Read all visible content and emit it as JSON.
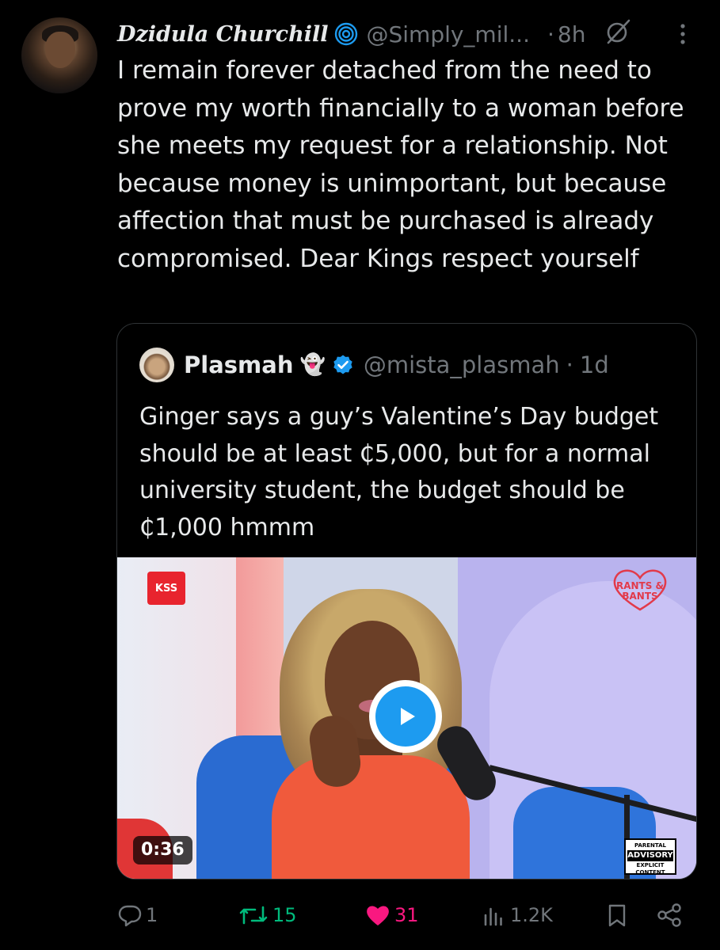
{
  "tweet": {
    "author_name": "Dzidula Churchill",
    "handle": "@Simply_mil...",
    "separator": "·",
    "time": "8h",
    "text": "I remain forever detached from the need to prove my worth financially to a woman before she meets my request for a relationship. Not because money is unimportant, but because affection that must be purchased is already compromised. Dear Kings respect yourself"
  },
  "quote": {
    "author_name": "Plasmah",
    "emoji": "👻",
    "handle": "@mista_plasmah",
    "separator": "·",
    "time": "1d",
    "text": "Ginger says a guy’s Valentine’s Day budget should be at least ₵5,000, but for a normal university student, the budget should be ₵1,000 hmmm",
    "media": {
      "type": "video",
      "duration": "0:36",
      "logo_left": "KSS",
      "logo_right": "RANTS & BANTS",
      "advisory_top": "PARENTAL",
      "advisory_main": "ADVISORY",
      "advisory_bottom": "EXPLICIT CONTENT"
    }
  },
  "actions": {
    "replies": "1",
    "reposts": "15",
    "likes": "31",
    "views": "1.2K"
  },
  "colors": {
    "background": "#000000",
    "text": "#e7e9ea",
    "muted": "#71767b",
    "border": "#2f3336",
    "accent_blue": "#1d9bf0",
    "repost_green": "#00ba7c",
    "like_pink": "#f91880"
  },
  "icons": {
    "verified": "swirl-verified-icon",
    "grok": "grok-icon",
    "more": "more-vertical-icon",
    "reply": "reply-icon",
    "repost": "repost-icon",
    "like": "heart-icon",
    "views": "views-icon",
    "bookmark": "bookmark-icon",
    "share": "share-icon",
    "play": "play-icon"
  }
}
